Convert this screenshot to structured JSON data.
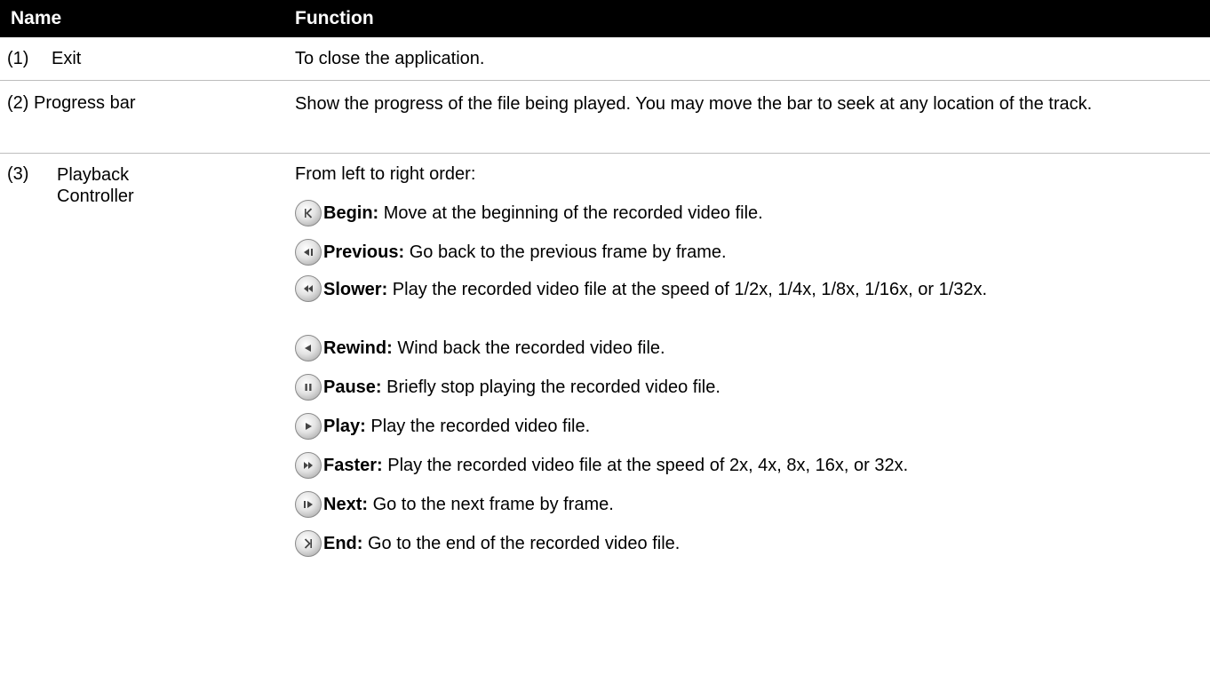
{
  "header": {
    "name_label": "Name",
    "function_label": "Function"
  },
  "rows": [
    {
      "num": "(1)",
      "name": "Exit",
      "function": "To close the application."
    },
    {
      "num": "(2)",
      "name": "Progress bar",
      "function": "Show the progress of the file being played. You may move the bar to seek at any location of the track."
    },
    {
      "num": "(3)",
      "name_line1": "Playback",
      "name_line2": "Controller",
      "intro": "From left to right order:"
    }
  ],
  "controls": [
    {
      "icon": "begin-icon",
      "label": "Begin:",
      "desc": " Move at the beginning of the recorded video file."
    },
    {
      "icon": "previous-icon",
      "label": "Previous:",
      "desc": " Go back to the previous frame by frame."
    },
    {
      "icon": "slower-icon",
      "label": "Slower:",
      "desc": " Play the recorded video file at the speed of 1/2x, 1/4x, 1/8x, 1/16x, or 1/32x."
    },
    {
      "icon": "rewind-icon",
      "label": "Rewind:",
      "desc": " Wind back the recorded video file."
    },
    {
      "icon": "pause-icon",
      "label": "Pause:",
      "desc": " Briefly stop playing the recorded video file."
    },
    {
      "icon": "play-icon",
      "label": "Play:",
      "desc": " Play the recorded video file."
    },
    {
      "icon": "faster-icon",
      "label": "Faster:",
      "desc": " Play the recorded video file at the speed of 2x, 4x, 8x, 16x, or 32x."
    },
    {
      "icon": "next-icon",
      "label": "Next:",
      "desc": " Go to the next frame by frame."
    },
    {
      "icon": "end-icon",
      "label": "End:",
      "desc": " Go to the end of the recorded video file."
    }
  ],
  "colors": {
    "header_bg": "#000000",
    "header_text": "#ffffff",
    "row_border": "#bdbdbd"
  }
}
